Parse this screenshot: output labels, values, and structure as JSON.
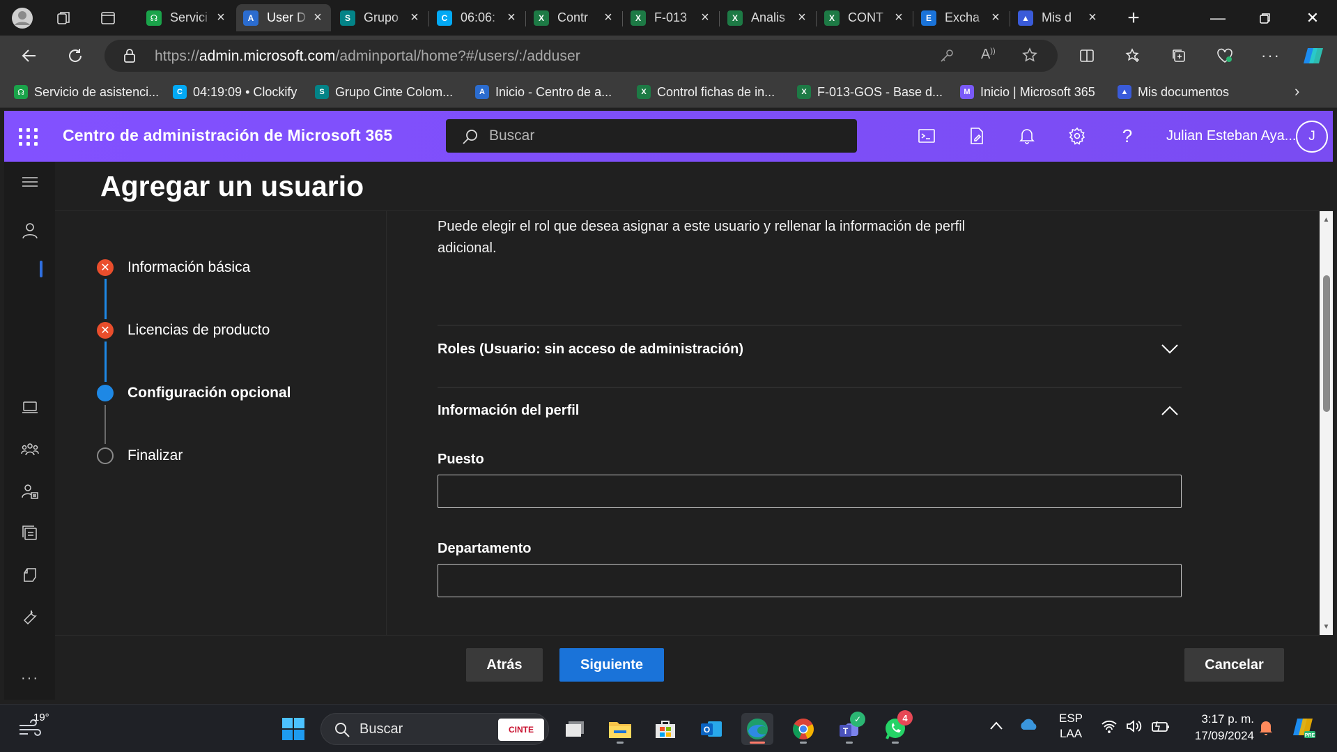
{
  "browser": {
    "tabs": [
      {
        "title": "Servici",
        "icon": "headset-icon",
        "color": "#1aa34a"
      },
      {
        "title": "User D",
        "icon": "admin-icon",
        "color": "#2b6ccf",
        "active": true
      },
      {
        "title": "Grupo",
        "icon": "sharepoint-icon",
        "color": "#038387"
      },
      {
        "title": "06:06:",
        "icon": "clockify-icon",
        "color": "#03a9f4"
      },
      {
        "title": "Contr",
        "icon": "excel-icon",
        "color": "#1d7a45"
      },
      {
        "title": "F-013",
        "icon": "excel-icon",
        "color": "#1d7a45"
      },
      {
        "title": "Analis",
        "icon": "excel-icon",
        "color": "#1d7a45"
      },
      {
        "title": "CONT",
        "icon": "excel-icon",
        "color": "#1d7a45"
      },
      {
        "title": "Excha",
        "icon": "exchange-icon",
        "color": "#1a73d9"
      },
      {
        "title": "Mis d",
        "icon": "docs-icon",
        "color": "#3a5bd9"
      }
    ],
    "url_prefix": "https://",
    "url_domain": "admin.microsoft.com",
    "url_path": "/adminportal/home?#/users/:/adduser",
    "favorites": [
      {
        "label": "Servicio de asistenci...",
        "icon": "headset-icon",
        "color": "#1aa34a"
      },
      {
        "label": "04:19:09 • Clockify",
        "icon": "clockify-icon",
        "color": "#03a9f4"
      },
      {
        "label": "Grupo Cinte Colom...",
        "icon": "sharepoint-icon",
        "color": "#038387"
      },
      {
        "label": "Inicio - Centro de a...",
        "icon": "admin-icon",
        "color": "#2b6ccf"
      },
      {
        "label": "Control fichas de in...",
        "icon": "excel-icon",
        "color": "#1d7a45"
      },
      {
        "label": "F-013-GOS - Base d...",
        "icon": "excel-icon",
        "color": "#1d7a45"
      },
      {
        "label": "Inicio | Microsoft 365",
        "icon": "m365-icon",
        "color": "#7a5af8"
      },
      {
        "label": "Mis documentos",
        "icon": "docs-icon",
        "color": "#3a5bd9"
      }
    ]
  },
  "header": {
    "app_title": "Centro de administración de Microsoft 365",
    "search_placeholder": "Buscar",
    "user_name": "Julian Esteban Aya...",
    "avatar_initial": "J",
    "accent": "#7c4dff"
  },
  "page": {
    "title": "Agregar un usuario",
    "steps": [
      {
        "label": "Información básica",
        "state": "error"
      },
      {
        "label": "Licencias de producto",
        "state": "error"
      },
      {
        "label": "Configuración opcional",
        "state": "current"
      },
      {
        "label": "Finalizar",
        "state": "pending"
      }
    ],
    "intro": "Puede elegir el rol que desea asignar a este usuario y rellenar la información de perfil adicional.",
    "sections": {
      "roles": "Roles (Usuario: sin acceso de administración)",
      "profile": "Información del perfil"
    },
    "fields": {
      "job_title_label": "Puesto",
      "job_title_value": "",
      "department_label": "Departamento",
      "department_value": ""
    },
    "buttons": {
      "back": "Atrás",
      "next": "Siguiente",
      "cancel": "Cancelar"
    }
  },
  "taskbar": {
    "weather_temp": "19°",
    "search_placeholder": "Buscar",
    "search_badge": "CINTE",
    "lang_top": "ESP",
    "lang_bottom": "LAA",
    "time": "3:17 p. m.",
    "date": "17/09/2024",
    "whatsapp_badge": "4"
  }
}
